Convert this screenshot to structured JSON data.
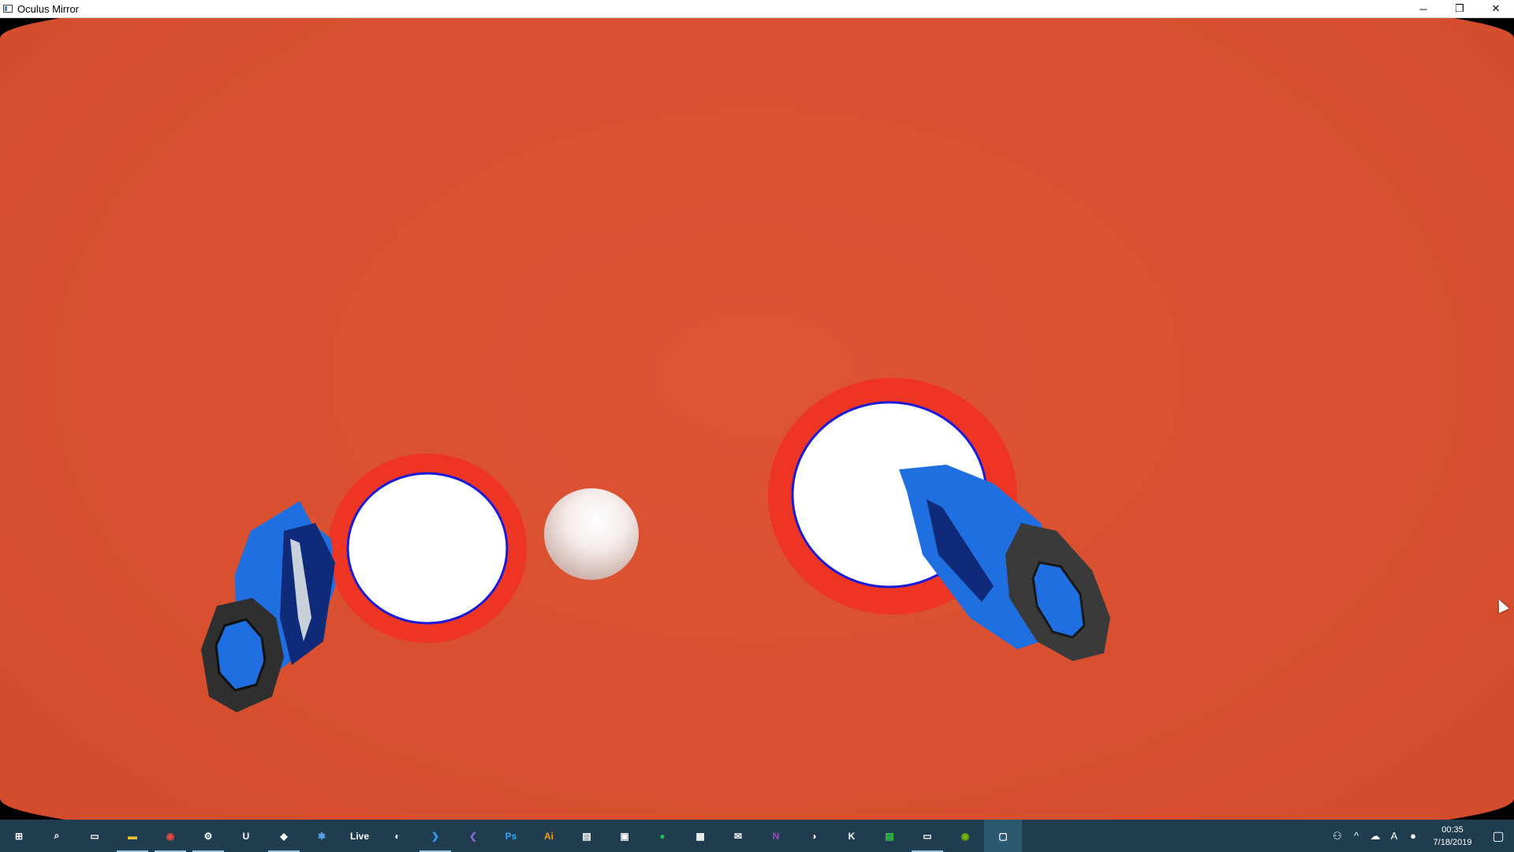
{
  "window": {
    "title": "Oculus Mirror",
    "minimize_glyph": "─",
    "restore_glyph": "❐",
    "close_glyph": "✕"
  },
  "colors": {
    "background": "#d8502f",
    "ring_red": "#ee3524",
    "ring_blue": "#1a1ad8",
    "controller_blue": "#1f6fe0",
    "controller_dark": "#3a3a3a",
    "taskbar": "#1f3d4e"
  },
  "scene": {
    "objects": [
      {
        "name": "left-controller",
        "icon": "vr-controller"
      },
      {
        "name": "left-teleport-ring",
        "icon": "ring"
      },
      {
        "name": "pearl-sphere",
        "icon": "sphere"
      },
      {
        "name": "right-teleport-ring",
        "icon": "ring"
      },
      {
        "name": "right-controller",
        "icon": "vr-controller"
      }
    ]
  },
  "taskbar": {
    "icons": [
      {
        "name": "start-icon",
        "glyph": "⊞",
        "color": "#ffffff"
      },
      {
        "name": "search-icon",
        "glyph": "⌕",
        "color": "#ffffff"
      },
      {
        "name": "task-view-icon",
        "glyph": "▭",
        "color": "#ffffff"
      },
      {
        "name": "file-explorer-icon",
        "glyph": "▬",
        "color": "#f3c231"
      },
      {
        "name": "chrome-icon",
        "glyph": "◉",
        "color": "#e9463c"
      },
      {
        "name": "steam-icon",
        "glyph": "⚙",
        "color": "#ffffff"
      },
      {
        "name": "unreal-icon",
        "glyph": "U",
        "color": "#ffffff"
      },
      {
        "name": "unity-icon",
        "glyph": "◆",
        "color": "#ffffff"
      },
      {
        "name": "network-icon",
        "glyph": "✱",
        "color": "#5aa6e8"
      },
      {
        "name": "live-icon",
        "glyph": "Live",
        "color": "#ffffff"
      },
      {
        "name": "blender-icon",
        "glyph": "◐",
        "color": "#ffffff"
      },
      {
        "name": "vscode-icon",
        "glyph": "❯",
        "color": "#2f9ef4"
      },
      {
        "name": "visual-studio-icon",
        "glyph": "❮",
        "color": "#8a63d2"
      },
      {
        "name": "photoshop-icon",
        "glyph": "Ps",
        "color": "#31a8ff"
      },
      {
        "name": "illustrator-icon",
        "glyph": "Ai",
        "color": "#ff9a00"
      },
      {
        "name": "books-icon",
        "glyph": "▤",
        "color": "#ffffff"
      },
      {
        "name": "photos-icon",
        "glyph": "▣",
        "color": "#ffffff"
      },
      {
        "name": "spotify-icon",
        "glyph": "●",
        "color": "#1db954"
      },
      {
        "name": "tool-icon",
        "glyph": "▦",
        "color": "#ffffff"
      },
      {
        "name": "mail-icon",
        "glyph": "✉",
        "color": "#ffffff"
      },
      {
        "name": "onenote-icon",
        "glyph": "N",
        "color": "#a54ac8"
      },
      {
        "name": "app-icon",
        "glyph": "◑",
        "color": "#ffffff"
      },
      {
        "name": "ak-icon",
        "glyph": "K",
        "color": "#ffffff"
      },
      {
        "name": "terminal-icon",
        "glyph": "▤",
        "color": "#2ecc40"
      },
      {
        "name": "oculus-icon",
        "glyph": "▭",
        "color": "#ffffff"
      },
      {
        "name": "nvidia-icon",
        "glyph": "◉",
        "color": "#76b900"
      },
      {
        "name": "oculus-mirror-icon",
        "glyph": "▢",
        "color": "#ffffff"
      }
    ],
    "tray": [
      {
        "name": "people-icon",
        "glyph": "⚇"
      },
      {
        "name": "chevron-up-icon",
        "glyph": "^"
      },
      {
        "name": "cloud-icon",
        "glyph": "☁"
      },
      {
        "name": "font-icon",
        "glyph": "A"
      },
      {
        "name": "globe-icon",
        "glyph": "●"
      }
    ],
    "time": "00:35",
    "date": "7/18/2019",
    "notification_glyph": "▢"
  }
}
